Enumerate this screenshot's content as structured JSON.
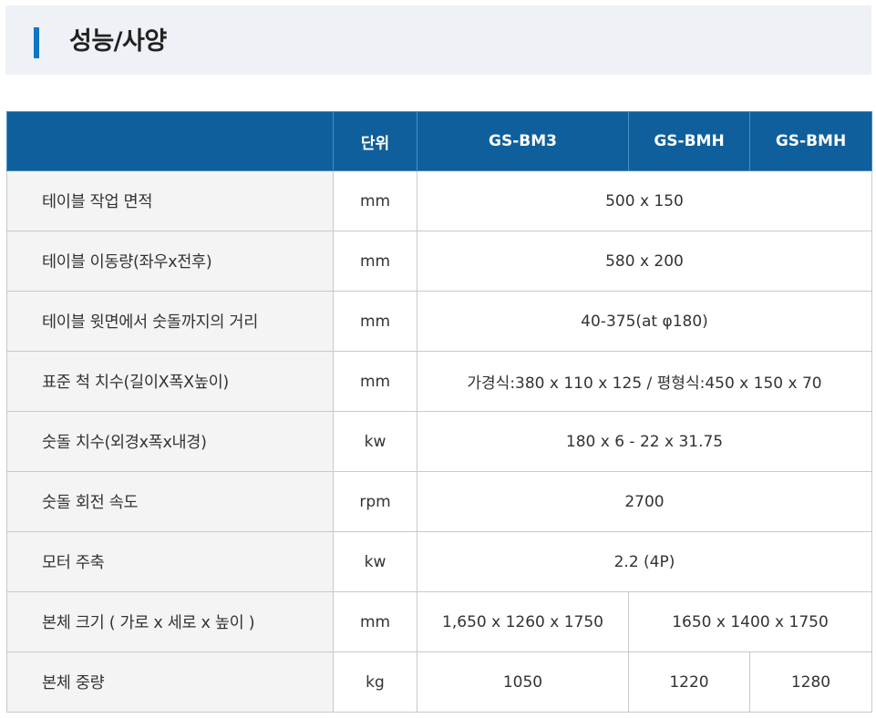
{
  "page": {
    "title": "성능/사양"
  },
  "table": {
    "headers": {
      "label": "",
      "unit": "단위",
      "model1": "GS-BM3",
      "model2": "GS-BMH",
      "model3": "GS-BMH"
    },
    "rows": [
      {
        "label": "테이블 작업 면적",
        "unit": "mm",
        "value": "500 x 150"
      },
      {
        "label": "테이블 이동량(좌우x전후)",
        "unit": "mm",
        "value": "580 x 200"
      },
      {
        "label": "테이블 윗면에서 숫돌까지의 거리",
        "unit": "mm",
        "value": "40-375(at φ180)"
      },
      {
        "label": "표준 척 치수(길이X폭X높이)",
        "unit": "mm",
        "value": "가경식:380 x 110 x 125 / 평형식:450 x 150 x 70"
      },
      {
        "label": "숫돌 치수(외경x폭x내경)",
        "unit": "kw",
        "value": "180 x 6 - 22 x 31.75"
      },
      {
        "label": "숫돌 회전 속도",
        "unit": "rpm",
        "value": "2700"
      },
      {
        "label": "모터 주축",
        "unit": "kw",
        "value": "2.2 (4P)"
      }
    ],
    "size_row": {
      "label": "본체 크기 ( 가로 x 세로 x 높이 )",
      "unit": "mm",
      "model1": "1,650 x 1260 x 1750",
      "model23": "1650 x 1400 x 1750"
    },
    "weight_row": {
      "label": "본체 중량",
      "unit": "kg",
      "model1": "1050",
      "model2": "1220",
      "model3": "1280"
    }
  }
}
